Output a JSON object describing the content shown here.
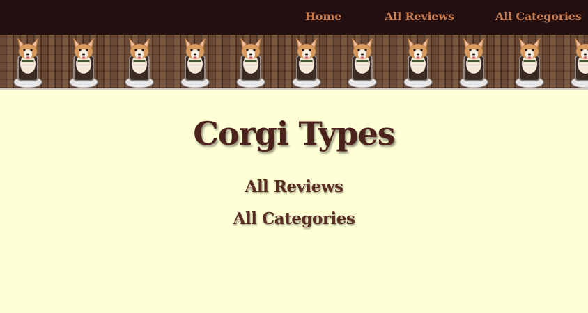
{
  "nav": {
    "home": "Home",
    "all_reviews": "All Reviews",
    "all_categories": "All Categories"
  },
  "banner": {
    "image": "corgi-in-toilet-pattern",
    "tile_count": 11
  },
  "main": {
    "title": "Corgi Types",
    "links": {
      "all_reviews": "All Reviews",
      "all_categories": "All Categories"
    }
  },
  "colors": {
    "nav_bg": "#240f11",
    "nav_link": "#c77d52",
    "page_bg": "#ffffd6",
    "title": "#4b231c",
    "link": "#5b2e24"
  }
}
